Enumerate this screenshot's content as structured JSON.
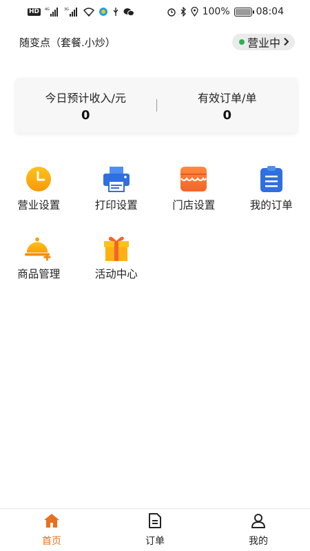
{
  "statusbar": {
    "left": {
      "hd": "HD",
      "sig1": "4G",
      "sig2": "3G"
    },
    "right": {
      "battery_pct": "100%",
      "time": "08:04"
    }
  },
  "header": {
    "shop_name": "随变点（套餐.小炒）",
    "status_label": "营业中",
    "status_color": "#2bb24c"
  },
  "stats": {
    "income_label": "今日预计收入/元",
    "income_value": "0",
    "orders_label": "有效订单/单",
    "orders_value": "0"
  },
  "menu": {
    "items": [
      {
        "label": "营业设置",
        "icon": "clock-icon"
      },
      {
        "label": "打印设置",
        "icon": "printer-icon"
      },
      {
        "label": "门店设置",
        "icon": "store-icon"
      },
      {
        "label": "我的订单",
        "icon": "clipboard-icon"
      },
      {
        "label": "商品管理",
        "icon": "dish-cover-icon"
      },
      {
        "label": "活动中心",
        "icon": "gift-icon"
      }
    ]
  },
  "tabbar": {
    "tabs": [
      {
        "label": "首页",
        "icon": "home-icon",
        "active": true
      },
      {
        "label": "订单",
        "icon": "document-icon",
        "active": false
      },
      {
        "label": "我的",
        "icon": "user-icon",
        "active": false
      }
    ],
    "active_color": "#e8701e"
  }
}
